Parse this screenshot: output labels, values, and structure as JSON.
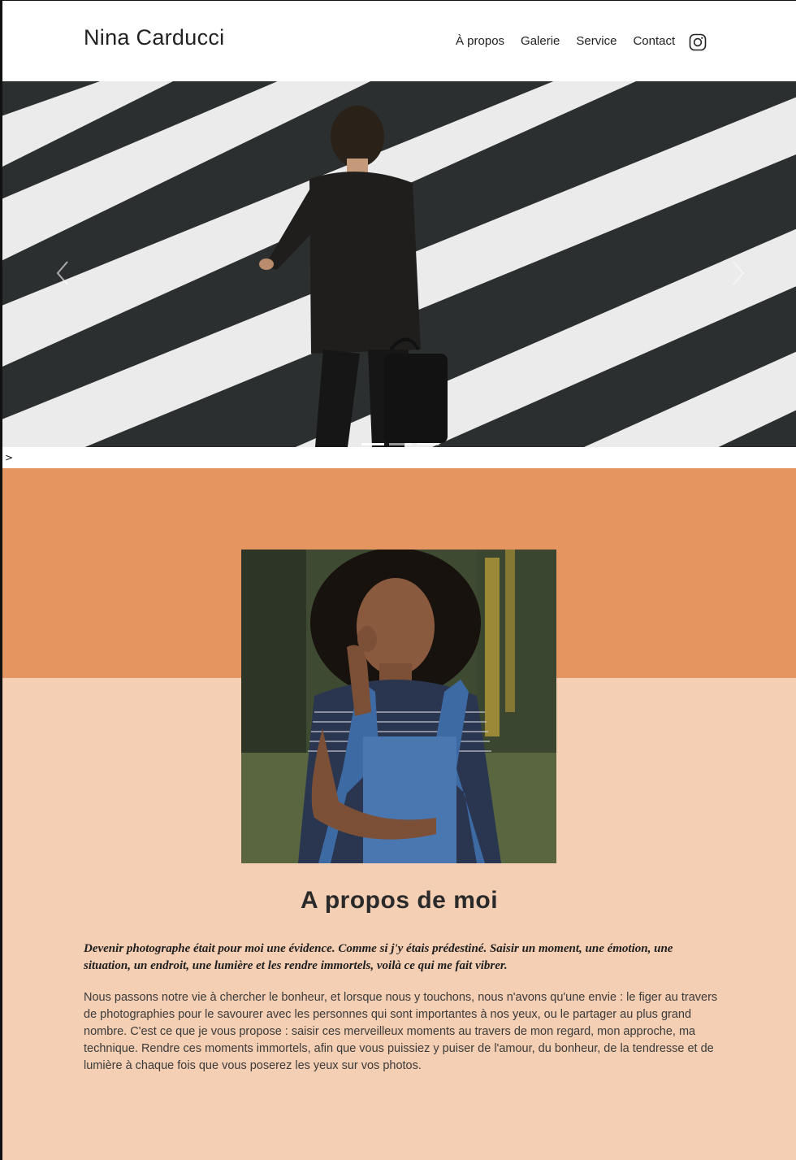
{
  "header": {
    "brand": "Nina Carducci",
    "nav": [
      {
        "label": "À propos"
      },
      {
        "label": "Galerie"
      },
      {
        "label": "Service"
      },
      {
        "label": "Contact"
      }
    ],
    "social_icon": "instagram-icon"
  },
  "hero": {
    "prev_icon": "chevron-left-icon",
    "next_icon": "chevron-right-icon",
    "indicators": 3,
    "active_indicator": 0
  },
  "stray_text": ">",
  "about": {
    "title": "A propos de moi",
    "lead": "Devenir photographe était pour moi une évidence. Comme si j'y étais prédestiné. Saisir un moment, une émotion, une situation, un endroit, une lumière et les rendre immortels, voilà ce qui me fait vibrer.",
    "body": "Nous passons notre vie à chercher le bonheur, et lorsque nous y touchons, nous n'avons qu'une envie : le figer au travers de photographies pour le savourer avec les personnes qui sont importantes à nos yeux, ou le partager au plus grand nombre. C'est ce que je vous propose : saisir ces merveilleux moments au travers de mon regard, mon approche, ma technique. Rendre ces moments immortels, afin que vous puissiez y puiser de l'amour, du bonheur, de la tendresse et de lumière à chaque fois que vous poserez les yeux sur vos photos."
  },
  "colors": {
    "accent_top": "#e5955f",
    "accent_bottom": "#f4cfb4",
    "text": "#222222"
  }
}
